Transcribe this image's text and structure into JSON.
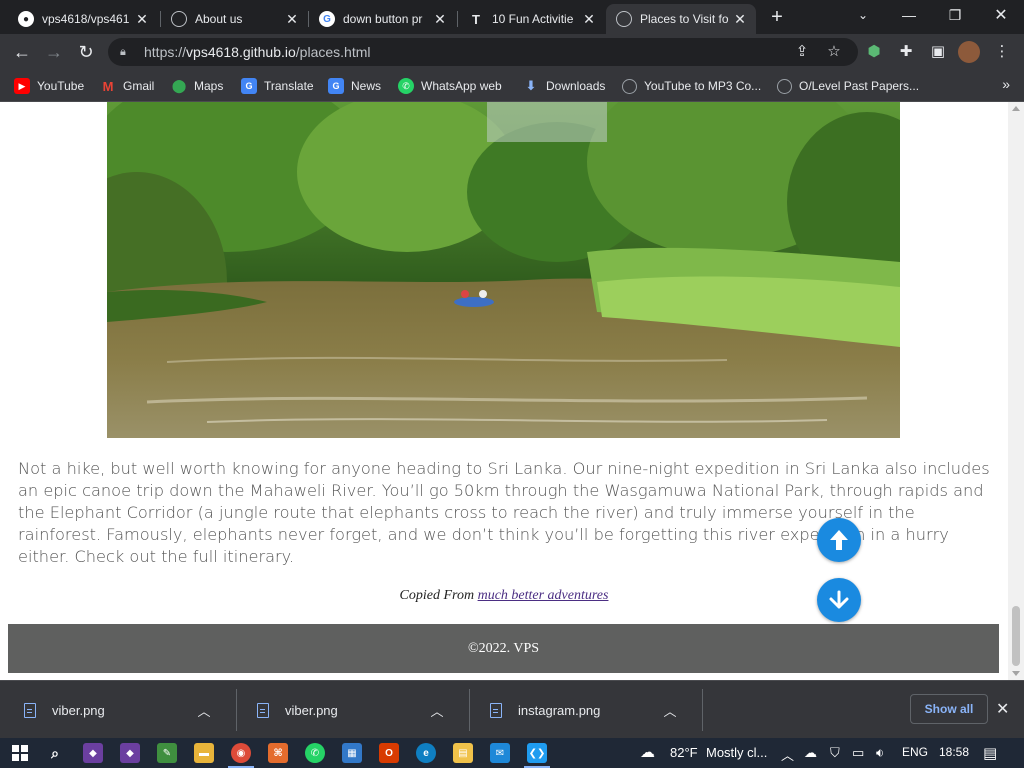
{
  "browser": {
    "tabs": [
      {
        "title": "vps4618/vps461",
        "icon": "github-icon",
        "active": false
      },
      {
        "title": "About us",
        "icon": "globe-icon",
        "active": false
      },
      {
        "title": "down button pr",
        "icon": "google-icon",
        "active": false
      },
      {
        "title": "10 Fun Activitie",
        "icon": "fun-site-icon",
        "active": false
      },
      {
        "title": "Places to Visit fo",
        "icon": "globe-icon",
        "active": true
      }
    ],
    "url": {
      "scheme": "https://",
      "host": "vps4618.github.io",
      "path": "/places.html"
    },
    "bookmarks": [
      {
        "label": "YouTube",
        "icon": "youtube-icon",
        "color": "#ff0000"
      },
      {
        "label": "Gmail",
        "icon": "gmail-icon",
        "color": "#ea4335"
      },
      {
        "label": "Maps",
        "icon": "maps-icon",
        "color": "#34a853"
      },
      {
        "label": "Translate",
        "icon": "translate-icon",
        "color": "#4285f4"
      },
      {
        "label": "News",
        "icon": "news-icon",
        "color": "#4285f4"
      },
      {
        "label": "WhatsApp web",
        "icon": "whatsapp-icon",
        "color": "#25d366"
      },
      {
        "label": "Downloads",
        "icon": "download-icon",
        "color": "#8ab4f8"
      },
      {
        "label": "YouTube to MP3 Co...",
        "icon": "globe-icon",
        "color": "#9aa0a6"
      },
      {
        "label": "O/Level Past Papers...",
        "icon": "globe-icon",
        "color": "#9aa0a6"
      }
    ]
  },
  "page": {
    "article_text": "Not a hike, but well worth knowing for anyone heading to Sri Lanka. Our nine-night expedition in Sri Lanka also includes an epic canoe trip down the Mahaweli River. You’ll go 50km through the Wasgamuwa National Park, through rapids and the Elephant Corridor (a jungle route that elephants cross to reach the river) and truly immerse yourself in the rainforest. Famously, elephants never forget, and we don’t think you’ll be forgetting this river expedition in a hurry either. Check out the full itinerary.",
    "credit_prefix": "Copied From",
    "credit_link": "much better adventures",
    "footer_text": "©2022. VPS"
  },
  "downloads": [
    {
      "file": "viber.png"
    },
    {
      "file": "viber.png"
    },
    {
      "file": "instagram.png"
    }
  ],
  "downloads_show_all": "Show all",
  "taskbar": {
    "weather_temp": "82°F",
    "weather_desc": "Mostly cl...",
    "language": "ENG",
    "time": "18:58"
  },
  "colors": {
    "fab": "#1a8ae0",
    "footer": "#5f605f",
    "chrome_dark": "#202124",
    "chrome_toolbar": "#35363a"
  }
}
